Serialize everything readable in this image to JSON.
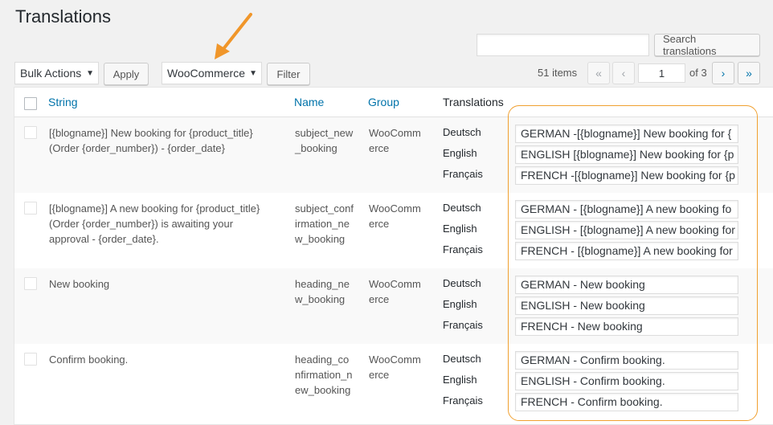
{
  "page": {
    "title": "Translations"
  },
  "search": {
    "button_label": "Search translations",
    "value": ""
  },
  "bulk": {
    "selected": "Bulk Actions",
    "apply_label": "Apply"
  },
  "filter": {
    "selected": "WooCommerce",
    "button_label": "Filter"
  },
  "pagination": {
    "items_label": "51 items",
    "first": "«",
    "prev": "‹",
    "current_page": "1",
    "of_label": "of 3",
    "next": "›",
    "last": "»"
  },
  "table": {
    "columns": {
      "string": "String",
      "name": "Name",
      "group": "Group",
      "translations": "Translations"
    },
    "rows": [
      {
        "string": "[{blogname}] New booking for {product_title} (Order {order_number}) - {order_date}",
        "name": "subject_new_booking",
        "group": "WooCommerce",
        "langs": [
          "Deutsch",
          "English",
          "Français"
        ],
        "values": [
          "GERMAN -[{blogname}] New booking for {",
          "ENGLISH [{blogname}] New booking for {p",
          "FRENCH -[{blogname}] New booking for {p"
        ]
      },
      {
        "string": "[{blogname}] A new booking for {product_title} (Order {order_number}) is awaiting your approval - {order_date}.",
        "name": "subject_confirmation_new_booking",
        "group": "WooCommerce",
        "langs": [
          "Deutsch",
          "English",
          "Français"
        ],
        "values": [
          "GERMAN - [{blogname}] A new booking fo",
          "ENGLISH - [{blogname}] A new booking for",
          "FRENCH - [{blogname}] A new booking for"
        ]
      },
      {
        "string": "New booking",
        "name": "heading_new_booking",
        "group": "WooCommerce",
        "langs": [
          "Deutsch",
          "English",
          "Français"
        ],
        "values": [
          "GERMAN - New booking",
          "ENGLISH - New booking",
          "FRENCH - New booking"
        ]
      },
      {
        "string": "Confirm booking.",
        "name": "heading_confirmation_new_booking",
        "group": "WooCommerce",
        "langs": [
          "Deutsch",
          "English",
          "Français"
        ],
        "values": [
          "GERMAN - Confirm booking.",
          "ENGLISH - Confirm booking.",
          "FRENCH - Confirm booking."
        ]
      }
    ]
  },
  "colors": {
    "accent": "#0073aa",
    "highlight": "#f0a030",
    "arrow": "#f0962a"
  },
  "icons": {
    "dropdown": "triangle-down-icon",
    "annotation": "arrow-annotation-icon"
  }
}
